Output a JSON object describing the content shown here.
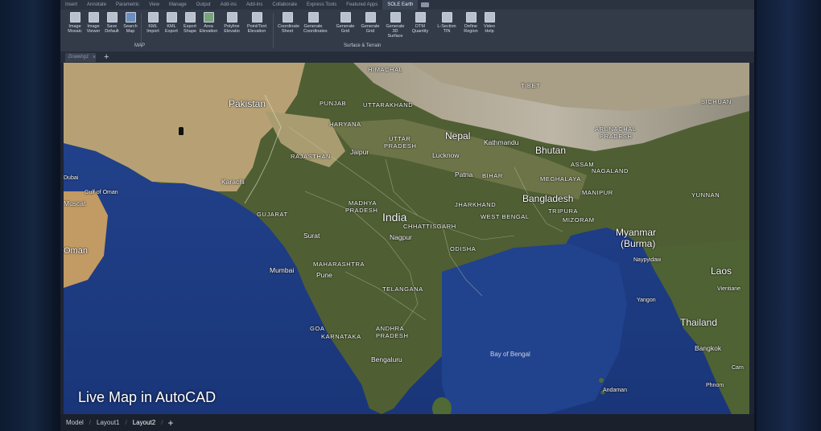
{
  "ribbon_tabs": [
    "Insert",
    "Annotate",
    "Parametric",
    "View",
    "Manage",
    "Output",
    "Add-ins",
    "Add-ins",
    "Collaborate",
    "Express Tools",
    "Featured Apps",
    "SOLE Earth"
  ],
  "active_tab": "SOLE Earth",
  "tools": [
    {
      "label1": "Image",
      "label2": "Mosaic"
    },
    {
      "label1": "Image",
      "label2": "Viewer"
    },
    {
      "label1": "Save",
      "label2": "Default"
    },
    {
      "label1": "Search",
      "label2": "Map"
    },
    {
      "label1": "KML",
      "label2": "Import"
    },
    {
      "label1": "KML",
      "label2": "Export"
    },
    {
      "label1": "Export",
      "label2": "Shape"
    },
    {
      "label1": "Area",
      "label2": "Elevation"
    },
    {
      "label1": "Polyline",
      "label2": "Elevatio"
    },
    {
      "label1": "Point/Text",
      "label2": "Elevation"
    },
    {
      "label1": "Coordinate",
      "label2": "Sheet"
    },
    {
      "label1": "Generate",
      "label2": "Coordinates"
    },
    {
      "label1": "Generate",
      "label2": "Grid"
    },
    {
      "label1": "Generate",
      "label2": "Grid"
    },
    {
      "label1": "Generate",
      "label2": "3D Surface"
    },
    {
      "label1": "DTM",
      "label2": "Quantity"
    },
    {
      "label1": "L-Section",
      "label2": "TIN"
    },
    {
      "label1": "Define",
      "label2": "Region"
    },
    {
      "label1": "Video",
      "label2": "Help"
    }
  ],
  "groups": {
    "map": "MAP",
    "surface": "Surface & Terrain"
  },
  "doc_tab": "Drawing1",
  "layouts": [
    "Model",
    "Layout1",
    "Layout2"
  ],
  "active_layout": "Layout2",
  "add_symbol": "+",
  "map_labels": {
    "pakistan": "Pakistan",
    "india": "India",
    "nepal": "Nepal",
    "bhutan": "Bhutan",
    "bangladesh": "Bangladesh",
    "myanmar": "Myanmar",
    "burma": "(Burma)",
    "laos": "Laos",
    "thailand": "Thailand",
    "tibet": "TIBET",
    "sichuan": "SICHUAN",
    "yunnan": "YUNNAN",
    "oman": "Oman",
    "muscat": "Muscat",
    "gulf_oman": "Gulf of Oman",
    "bay": "Bay of Bengal",
    "himachal": "HIMACHAL",
    "punjab": "PUNJAB",
    "uttarakhand": "UTTARAKHAND",
    "haryana": "HARYANA",
    "uttar": "UTTAR",
    "pradesh1": "PRADESH",
    "rajasthan": "RAJASTHAN",
    "jaipur": "Jaipur",
    "lucknow": "Lucknow",
    "kathmandu": "Kathmandu",
    "arunachal": "ARUNACHAL",
    "pradesh2": "PRADESH",
    "assam": "ASSAM",
    "nagaland": "NAGALAND",
    "meghalaya": "MEGHALAYA",
    "manipur": "MANIPUR",
    "tripura": "TRIPURA",
    "mizoram": "MIZORAM",
    "bihar": "BIHAR",
    "patna": "Patna",
    "karachi": "Karachi",
    "gujarat": "GUJARAT",
    "madhya": "MADHYA",
    "pradesh3": "PRADESH",
    "jharkhand": "JHARKHAND",
    "westbengal": "WEST BENGAL",
    "chhattisgarh": "CHHATTISGARH",
    "surat": "Surat",
    "nagpur": "Nagpur",
    "odisha": "ODISHA",
    "maharashtra": "MAHARASHTRA",
    "mumbai": "Mumbai",
    "pune": "Pune",
    "telangana": "TELANGANA",
    "goa": "GOA",
    "andhra": "ANDHRA",
    "pradesh4": "PRADESH",
    "karnataka": "KARNATAKA",
    "bengaluru": "Bengaluru",
    "naypyidaw": "Naypyidaw",
    "yangon": "Yangon",
    "vientiane": "Vientiane",
    "bangkok": "Bangkok",
    "phnompenh": "Phnom",
    "cam": "Cam",
    "dubai": "Dubai",
    "andaman": "Andaman"
  },
  "caption": "Live Map in AutoCAD",
  "colors": {
    "ocean": "#1f3f8a",
    "land_green": "#4a5e2e",
    "land_desert": "#b8a272",
    "mountain": "#c9c3b4"
  }
}
